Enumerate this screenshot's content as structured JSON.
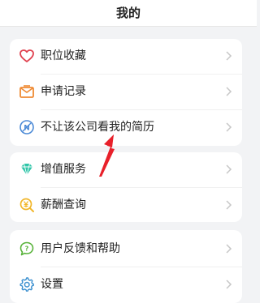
{
  "header": {
    "title": "我的"
  },
  "groups": [
    {
      "items": [
        {
          "label": "职位收藏",
          "icon": "heart-icon",
          "icon_color": "#e0414f"
        },
        {
          "label": "申请记录",
          "icon": "mail-icon",
          "icon_color": "#ef8a33"
        },
        {
          "label": "不让该公司看我的简历",
          "icon": "no-view-icon",
          "icon_color": "#4c8ad6"
        }
      ]
    },
    {
      "items": [
        {
          "label": "增值服务",
          "icon": "diamond-icon",
          "icon_color": "#2fc5a8"
        },
        {
          "label": "薪酬查询",
          "icon": "salary-icon",
          "icon_color": "#f1b62a"
        }
      ]
    },
    {
      "items": [
        {
          "label": "用户反馈和帮助",
          "icon": "feedback-icon",
          "icon_color": "#59b33b"
        },
        {
          "label": "设置",
          "icon": "gear-icon",
          "icon_color": "#3a8fcf"
        }
      ]
    }
  ],
  "annotation": {
    "color": "#e8202a"
  }
}
